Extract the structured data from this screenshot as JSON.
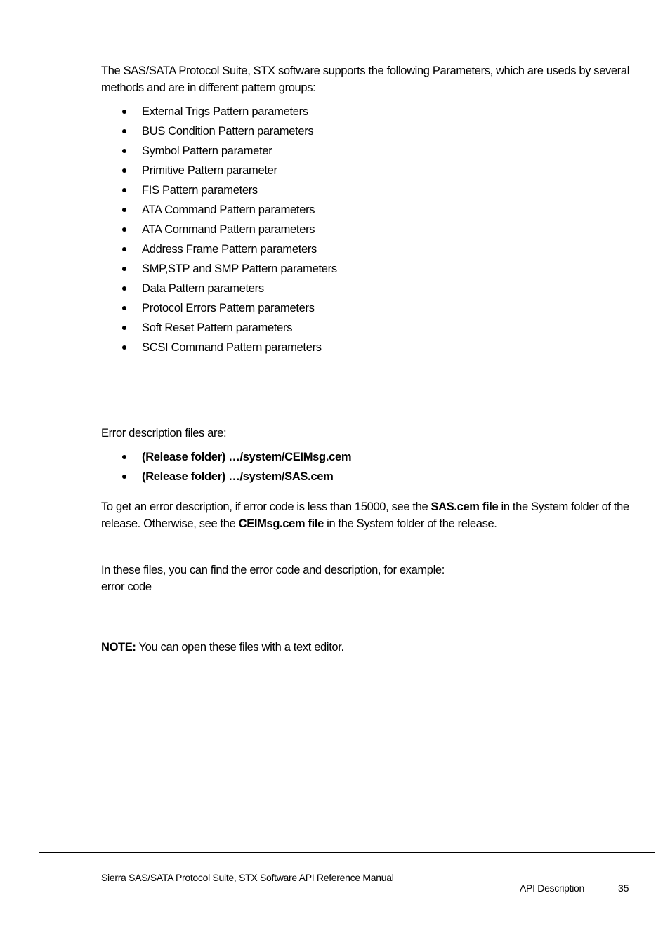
{
  "intro": {
    "text": "The SAS/SATA Protocol Suite, STX software supports the following Parameters, which are useds by several methods and are in different pattern groups:"
  },
  "parameter_groups": [
    "External Trigs Pattern parameters",
    "BUS Condition Pattern parameters",
    "Symbol Pattern parameter",
    "Primitive Pattern parameter",
    "FIS Pattern parameters",
    "ATA Command Pattern parameters",
    "ATA Command Pattern parameters",
    "Address Frame Pattern parameters",
    "SMP,STP and SMP Pattern parameters",
    "Data Pattern parameters",
    "Protocol Errors Pattern parameters",
    "Soft Reset Pattern parameters",
    "SCSI Command Pattern parameters"
  ],
  "error_files": {
    "intro": "Error description files are:",
    "files": [
      "(Release folder) …/system/CEIMsg.cem",
      "(Release folder) …/system/SAS.cem"
    ]
  },
  "description": {
    "part1": "To get an error description, if error code is less than 15000, see the ",
    "bold1": "SAS.cem file",
    "part2": " in the System folder of the release. Otherwise, see the ",
    "bold2": "CEIMsg.cem file",
    "part3": " in the System folder of the release."
  },
  "example": {
    "line1": "In these files, you can find the error code and description, for example:",
    "line2": "error code"
  },
  "note": {
    "label": "NOTE:",
    "text": " You can open these files with a text editor."
  },
  "footer": {
    "title": "Sierra SAS/SATA Protocol Suite, STX Software API Reference Manual",
    "section": "API Description",
    "page_number": "35"
  }
}
